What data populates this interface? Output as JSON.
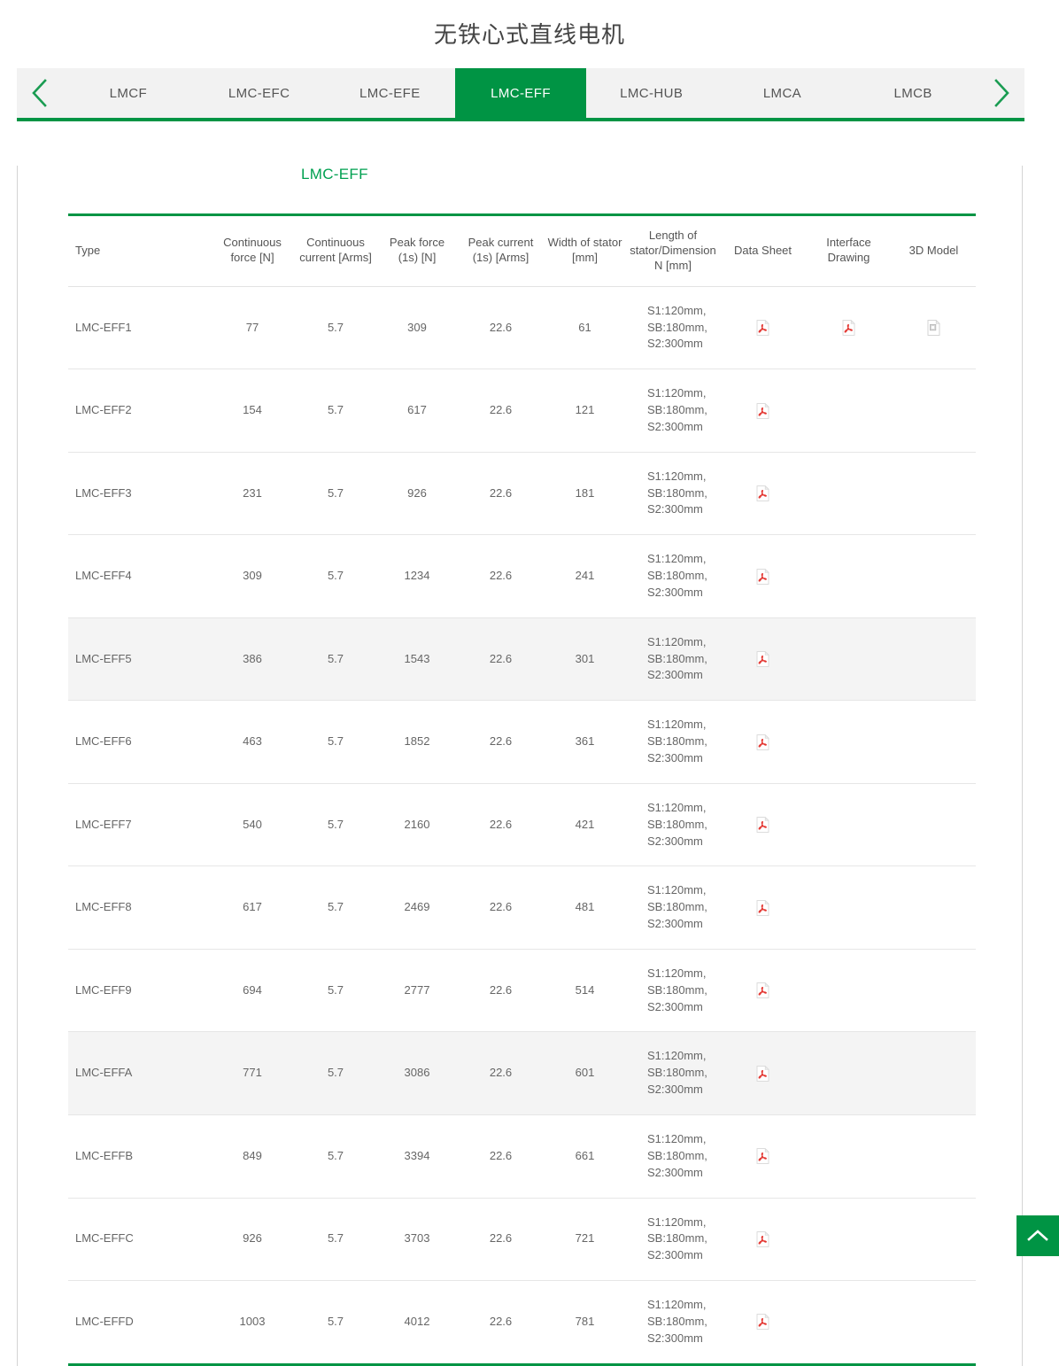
{
  "header": {
    "title": "无铁心式直线电机"
  },
  "tabbar": {
    "prev_label": "chevron-left-icon",
    "next_label": "chevron-right-icon",
    "active_index": 3,
    "tabs": [
      {
        "label": "LMCF"
      },
      {
        "label": "LMC-EFC"
      },
      {
        "label": "LMC-EFE"
      },
      {
        "label": "LMC-EFF"
      },
      {
        "label": "LMC-HUB"
      },
      {
        "label": "LMCA"
      },
      {
        "label": "LMCB"
      }
    ]
  },
  "content": {
    "section_title": "LMC-EFF",
    "table": {
      "columns": [
        "Type",
        "Continuous force [N]",
        "Continuous current [Arms]",
        "Peak force (1s) [N]",
        "Peak current (1s) [Arms]",
        "Width of stator [mm]",
        "Length of stator/Dimension N [mm]",
        "Data Sheet",
        "Interface Drawing",
        "3D Model"
      ],
      "rows": [
        {
          "type": "LMC-EFF1",
          "continuous_force": "77",
          "continuous_current": "5.7",
          "peak_force": "309",
          "peak_current": "22.6",
          "width_of_stator": "61",
          "length_of_stator": "S1:120mm,\nSB:180mm,\nS2:300mm",
          "data_sheet": "pdf-icon",
          "interface_drawing": "pdf-icon",
          "model_3d": "file-icon",
          "highlight": false
        },
        {
          "type": "LMC-EFF2",
          "continuous_force": "154",
          "continuous_current": "5.7",
          "peak_force": "617",
          "peak_current": "22.6",
          "width_of_stator": "121",
          "length_of_stator": "S1:120mm,\nSB:180mm,\nS2:300mm",
          "data_sheet": "pdf-icon",
          "interface_drawing": "",
          "model_3d": "",
          "highlight": false
        },
        {
          "type": "LMC-EFF3",
          "continuous_force": "231",
          "continuous_current": "5.7",
          "peak_force": "926",
          "peak_current": "22.6",
          "width_of_stator": "181",
          "length_of_stator": "S1:120mm,\nSB:180mm,\nS2:300mm",
          "data_sheet": "pdf-icon",
          "interface_drawing": "",
          "model_3d": "",
          "highlight": false
        },
        {
          "type": "LMC-EFF4",
          "continuous_force": "309",
          "continuous_current": "5.7",
          "peak_force": "1234",
          "peak_current": "22.6",
          "width_of_stator": "241",
          "length_of_stator": "S1:120mm,\nSB:180mm,\nS2:300mm",
          "data_sheet": "pdf-icon",
          "interface_drawing": "",
          "model_3d": "",
          "highlight": false
        },
        {
          "type": "LMC-EFF5",
          "continuous_force": "386",
          "continuous_current": "5.7",
          "peak_force": "1543",
          "peak_current": "22.6",
          "width_of_stator": "301",
          "length_of_stator": "S1:120mm,\nSB:180mm,\nS2:300mm",
          "data_sheet": "pdf-icon",
          "interface_drawing": "",
          "model_3d": "",
          "highlight": true
        },
        {
          "type": "LMC-EFF6",
          "continuous_force": "463",
          "continuous_current": "5.7",
          "peak_force": "1852",
          "peak_current": "22.6",
          "width_of_stator": "361",
          "length_of_stator": "S1:120mm,\nSB:180mm,\nS2:300mm",
          "data_sheet": "pdf-icon",
          "interface_drawing": "",
          "model_3d": "",
          "highlight": false
        },
        {
          "type": "LMC-EFF7",
          "continuous_force": "540",
          "continuous_current": "5.7",
          "peak_force": "2160",
          "peak_current": "22.6",
          "width_of_stator": "421",
          "length_of_stator": "S1:120mm,\nSB:180mm,\nS2:300mm",
          "data_sheet": "pdf-icon",
          "interface_drawing": "",
          "model_3d": "",
          "highlight": false
        },
        {
          "type": "LMC-EFF8",
          "continuous_force": "617",
          "continuous_current": "5.7",
          "peak_force": "2469",
          "peak_current": "22.6",
          "width_of_stator": "481",
          "length_of_stator": "S1:120mm,\nSB:180mm,\nS2:300mm",
          "data_sheet": "pdf-icon",
          "interface_drawing": "",
          "model_3d": "",
          "highlight": false
        },
        {
          "type": "LMC-EFF9",
          "continuous_force": "694",
          "continuous_current": "5.7",
          "peak_force": "2777",
          "peak_current": "22.6",
          "width_of_stator": "514",
          "length_of_stator": "S1:120mm,\nSB:180mm,\nS2:300mm",
          "data_sheet": "pdf-icon",
          "interface_drawing": "",
          "model_3d": "",
          "highlight": false
        },
        {
          "type": "LMC-EFFA",
          "continuous_force": "771",
          "continuous_current": "5.7",
          "peak_force": "3086",
          "peak_current": "22.6",
          "width_of_stator": "601",
          "length_of_stator": "S1:120mm,\nSB:180mm,\nS2:300mm",
          "data_sheet": "pdf-icon",
          "interface_drawing": "",
          "model_3d": "",
          "highlight": true
        },
        {
          "type": "LMC-EFFB",
          "continuous_force": "849",
          "continuous_current": "5.7",
          "peak_force": "3394",
          "peak_current": "22.6",
          "width_of_stator": "661",
          "length_of_stator": "S1:120mm,\nSB:180mm,\nS2:300mm",
          "data_sheet": "pdf-icon",
          "interface_drawing": "",
          "model_3d": "",
          "highlight": false
        },
        {
          "type": "LMC-EFFC",
          "continuous_force": "926",
          "continuous_current": "5.7",
          "peak_force": "3703",
          "peak_current": "22.6",
          "width_of_stator": "721",
          "length_of_stator": "S1:120mm,\nSB:180mm,\nS2:300mm",
          "data_sheet": "pdf-icon",
          "interface_drawing": "",
          "model_3d": "",
          "highlight": false
        },
        {
          "type": "LMC-EFFD",
          "continuous_force": "1003",
          "continuous_current": "5.7",
          "peak_force": "4012",
          "peak_current": "22.6",
          "width_of_stator": "781",
          "length_of_stator": "S1:120mm,\nSB:180mm,\nS2:300mm",
          "data_sheet": "pdf-icon",
          "interface_drawing": "",
          "model_3d": "",
          "highlight": false
        }
      ]
    }
  },
  "back_to_top": {
    "label": "chevron-up-icon"
  },
  "colors": {
    "brand_green": "#009444",
    "section_green": "#00a050",
    "tabbar_bg": "#f2f2f2",
    "row_alt_bg": "#f4f4f4",
    "pdf_red": "#e3342f",
    "text": "#555555"
  }
}
